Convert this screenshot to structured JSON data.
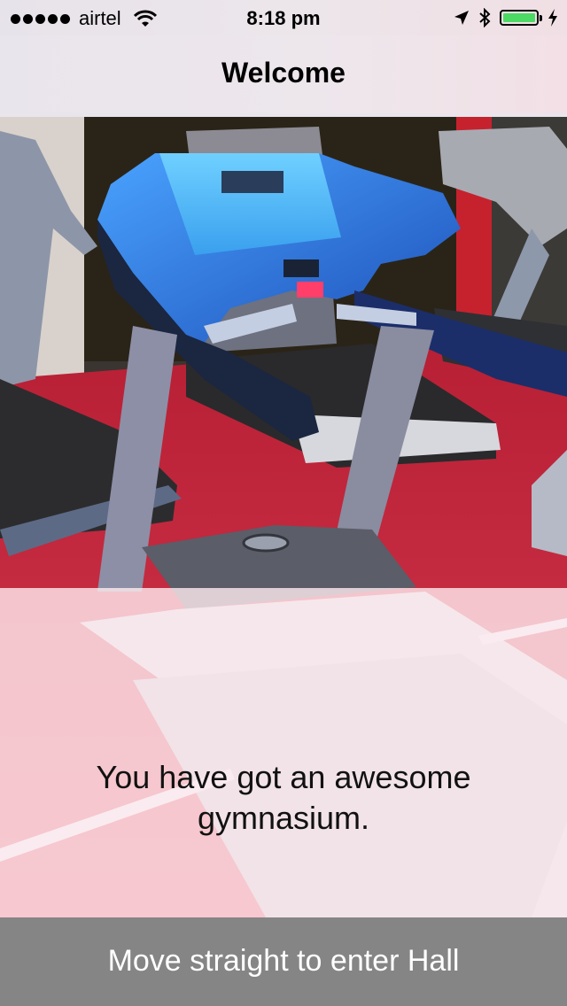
{
  "status_bar": {
    "carrier": "airtel",
    "time": "8:18 pm",
    "signal_bars": 5,
    "battery_level": 1.0,
    "icons": [
      "signal-dots-icon",
      "wifi-icon",
      "location-arrow-icon",
      "bluetooth-icon",
      "battery-icon",
      "charging-bolt-icon"
    ]
  },
  "nav": {
    "title": "Welcome"
  },
  "content": {
    "image": "treadmill-gym-photo",
    "message": "You have got an awesome gymnasium."
  },
  "bottom_bar": {
    "label": "Move straight to enter Hall"
  },
  "colors": {
    "battery_green": "#4cd964",
    "bottom_bar": "#858585",
    "carpet_red": "#c8283c",
    "treadmill_blue": "#2f6fe0"
  }
}
